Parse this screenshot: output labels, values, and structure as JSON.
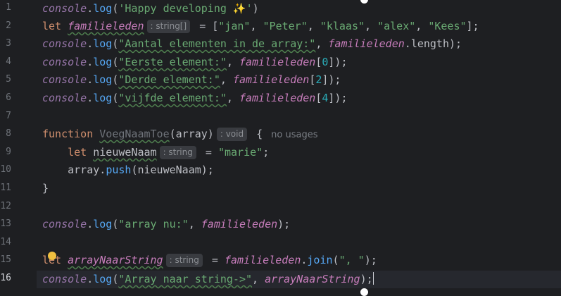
{
  "editor": {
    "line_numbers": [
      "1",
      "2",
      "3",
      "4",
      "5",
      "6",
      "7",
      "8",
      "9",
      "10",
      "11",
      "12",
      "13",
      "14",
      "15",
      "16"
    ],
    "active_line": "16",
    "colors": {
      "background": "#1e1f22",
      "keyword": "#cf8e6d",
      "string": "#6aab73",
      "number": "#2aacb8",
      "method": "#56a8f5",
      "variable": "#c77dbb"
    },
    "l1": {
      "obj": "console",
      "dot": ".",
      "fn": "log",
      "open": "(",
      "str": "'Happy developing ✨'",
      "close": ")"
    },
    "l2": {
      "kw": "let",
      "var": "familieleden",
      "hint": ": string[]",
      "eq": " = [",
      "s1": "\"jan\"",
      "c1": ", ",
      "s2": "\"Peter\"",
      "c2": ", ",
      "s3": "\"klaas\"",
      "c3": ", ",
      "s4": "\"alex\"",
      "c4": ", ",
      "s5": "\"Kees\"",
      "end": "];"
    },
    "l3": {
      "obj": "console",
      "dot": ".",
      "fn": "log",
      "open": "(",
      "str": "\"Aantal elementen in de array:\"",
      "comma": ", ",
      "var": "familieleden",
      "dot2": ".",
      "prop": "length",
      "end": ");"
    },
    "l4": {
      "obj": "console",
      "dot": ".",
      "fn": "log",
      "open": "(",
      "str": "\"Eerste element:\"",
      "comma": ", ",
      "var": "familieleden",
      "ob": "[",
      "num": "0",
      "end": "]);"
    },
    "l5": {
      "obj": "console",
      "dot": ".",
      "fn": "log",
      "open": "(",
      "str": "\"Derde element:\"",
      "comma": ", ",
      "var": "familieleden",
      "ob": "[",
      "num": "2",
      "end": "]);"
    },
    "l6": {
      "obj": "console",
      "dot": ".",
      "fn": "log",
      "open": "(",
      "str": "\"vijfde element:\"",
      "comma": ", ",
      "var": "familieleden",
      "ob": "[",
      "num": "4",
      "end": "]);"
    },
    "l8": {
      "kw": "function",
      "fn": "VoegNaamToe",
      "params": "(array)",
      "hint": ": void",
      "brace": " {",
      "usage": "no usages"
    },
    "l9": {
      "kw": "let",
      "var": "nieuweNaam",
      "hint": ": string",
      "eq": " = ",
      "str": "\"marie\"",
      "end": ";"
    },
    "l10": {
      "obj": "array",
      "dot": ".",
      "fn": "push",
      "args": "(nieuweNaam);"
    },
    "l11": {
      "brace": "}"
    },
    "l13": {
      "obj": "console",
      "dot": ".",
      "fn": "log",
      "open": "(",
      "str": "\"array nu:\"",
      "comma": ", ",
      "var": "familieleden",
      "end": ");"
    },
    "l15": {
      "kw": "let",
      "var": "arrayNaarString",
      "hint": ": string",
      "eq": " = ",
      "var2": "familieleden",
      "dot": ".",
      "fn": "join",
      "open": "(",
      "str": "\", \"",
      "end": ");"
    },
    "l16": {
      "obj": "console",
      "dot": ".",
      "fn": "log",
      "open": "(",
      "str": "\"Array naar string->\"",
      "comma": ", ",
      "var": "arrayNaarString",
      "end": ");"
    }
  }
}
